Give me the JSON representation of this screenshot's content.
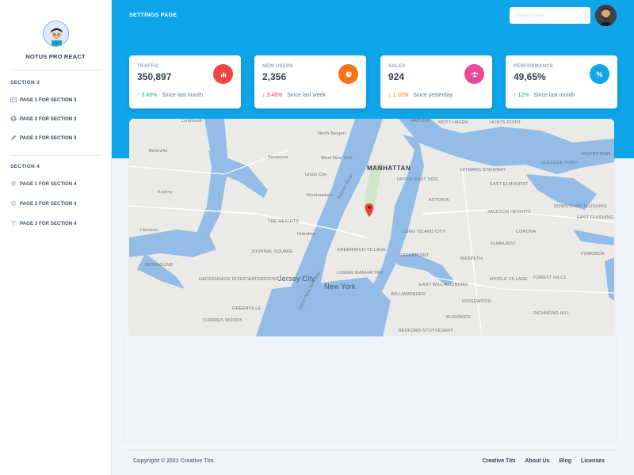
{
  "brand": {
    "name": "NOTUS PRO REACT"
  },
  "sidebar": {
    "sections": [
      {
        "title": "SECTION 3",
        "items": [
          {
            "label": "PAGE 1 FOR SECTION 3",
            "icon": "table-icon"
          },
          {
            "label": "PAGE 2 FOR SECTION 3",
            "icon": "user-circle-icon"
          },
          {
            "label": "PAGE 3 FOR SECTION 3",
            "icon": "pencil-icon"
          }
        ]
      },
      {
        "title": "SECTION 4",
        "items": [
          {
            "label": "PAGE 1 FOR SECTION 4",
            "icon": "shield-icon"
          },
          {
            "label": "PAGE 2 FOR SECTION 4",
            "icon": "gear-icon"
          },
          {
            "label": "PAGE 3 FOR SECTION 4",
            "icon": "filter-icon"
          }
        ]
      }
    ]
  },
  "header": {
    "title": "SETTINGS PAGE",
    "search_placeholder": "Search here..."
  },
  "stats": [
    {
      "label": "TRAFFIC",
      "value": "350,897",
      "change": "3.48%",
      "direction": "up",
      "since": "Since last month",
      "badge_color": "#ef4444",
      "icon": "chart-bar-icon"
    },
    {
      "label": "NEW USERS",
      "value": "2,356",
      "change": "3.48%",
      "direction": "down",
      "since": "Since last week",
      "badge_color": "#f97316",
      "icon": "pie-chart-icon"
    },
    {
      "label": "SALES",
      "value": "924",
      "change": "1.10%",
      "direction": "down",
      "since": "Since yesterday",
      "badge_color": "#ec4899",
      "icon": "users-icon"
    },
    {
      "label": "PERFORMANCE",
      "value": "49,65%",
      "change": "12%",
      "direction": "up",
      "since": "Since last month",
      "badge_color": "#0ea5e9",
      "icon": "percent-icon"
    }
  ],
  "map": {
    "labels": {
      "manhattan": "MANHATTAN",
      "new_york": "New York",
      "jersey_city": "Jersey City",
      "hoboken": "Hoboken",
      "union_city": "Union City",
      "secaucus": "Secaucus",
      "west_new_york": "West New York",
      "north_bergen": "North Bergen",
      "weehawken": "Weehawken",
      "astoria": "ASTORIA",
      "long_island_city": "LONG ISLAND CITY",
      "greenpoint": "GREENPOINT",
      "williamsburg": "WILLIAMSBURG",
      "bushwick": "BUSHWICK",
      "maspeth": "MASPETH",
      "ridgewood": "RIDGEWOOD",
      "harlem": "HARLEM",
      "mott_haven": "MOTT HAVEN",
      "hunts_point": "HUNTS POINT",
      "kearny": "Kearny",
      "harrison": "Harrison",
      "lyndhurst": "Lyndhurst",
      "belleville": "Belleville",
      "corona": "CORONA",
      "elmhurst": "ELMHURST",
      "flushing": "FLUSHING",
      "whitestone": "WHITESTONE",
      "jackson_heights": "JACKSON HEIGHTS",
      "east_elmhurst": "EAST ELMHURST",
      "college_point": "COLLEGE POINT",
      "upper_east_side": "UPPER EAST SIDE",
      "greenwich_village": "GREENWICH VILLAGE",
      "lower_manhattan": "LOWER MANHATTAN",
      "the_heights": "THE HEIGHTS",
      "journal_square": "JOURNAL SQUARE",
      "middle_village": "MIDDLE VILLAGE",
      "forest_hills": "FOREST HILLS",
      "richmond_hill": "RICHMOND HILL",
      "bedford_stuyvesant": "BEDFORD-STUYVESANT",
      "pomonok": "POMONOK",
      "ironbound": "IRONBOUND",
      "hackensack": "HACKENSACK RIVER WATERFRONT",
      "curries_woods": "CURRIES WOODS",
      "greenville": "GREENVILLE",
      "ditmars": "DITMARS STEINWAY",
      "east_flushing": "EAST FLUSHING",
      "downtown_flushing": "DOWNTOWN FLUSHING",
      "east_williamsburg": "EAST WILLIAMSBURG",
      "hudson_river": "Hudson River",
      "upper_bay": "Upper New York Bay"
    }
  },
  "footer": {
    "copyright": "Copyright © 2021 Creative Tim",
    "links": [
      "Creative Tim",
      "About Us",
      "Blog",
      "Licenses"
    ]
  }
}
